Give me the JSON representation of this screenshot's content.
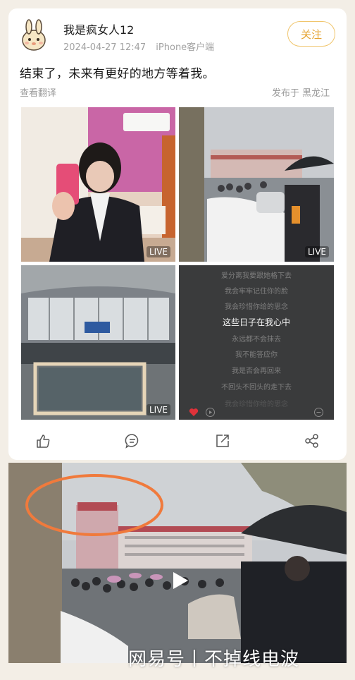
{
  "post": {
    "username": "我是疯女人12",
    "timestamp": "2024-04-27 12:47",
    "client": "iPhone客户端",
    "follow_label": "关注",
    "text": "结束了，未来有更好的地方等着我。",
    "translate_label": "查看翻译",
    "location": "发布于 黑龙江"
  },
  "photos": [
    {
      "badge": "LIVE"
    },
    {
      "badge": "LIVE"
    },
    {
      "badge": "LIVE"
    }
  ],
  "lyrics": [
    "爱分离我要跟她格下去",
    "我会牢牢记住你的脸",
    "我会珍惜你给的思念",
    "这些日子在我心中",
    "永远都不会抹去",
    "我不能答应你",
    "我是否会再回来",
    "不回头不回头的走下去",
    "我会珍惜你给的思念"
  ],
  "actions": [
    {
      "icon": "like-icon"
    },
    {
      "icon": "comment-icon"
    },
    {
      "icon": "repost-icon"
    },
    {
      "icon": "share-icon"
    }
  ],
  "watermark": "网易号丨不掉线电波",
  "colors": {
    "background": "#f3eee6",
    "follow_accent": "#e5a330",
    "annotation_circle": "#f07a3c"
  }
}
